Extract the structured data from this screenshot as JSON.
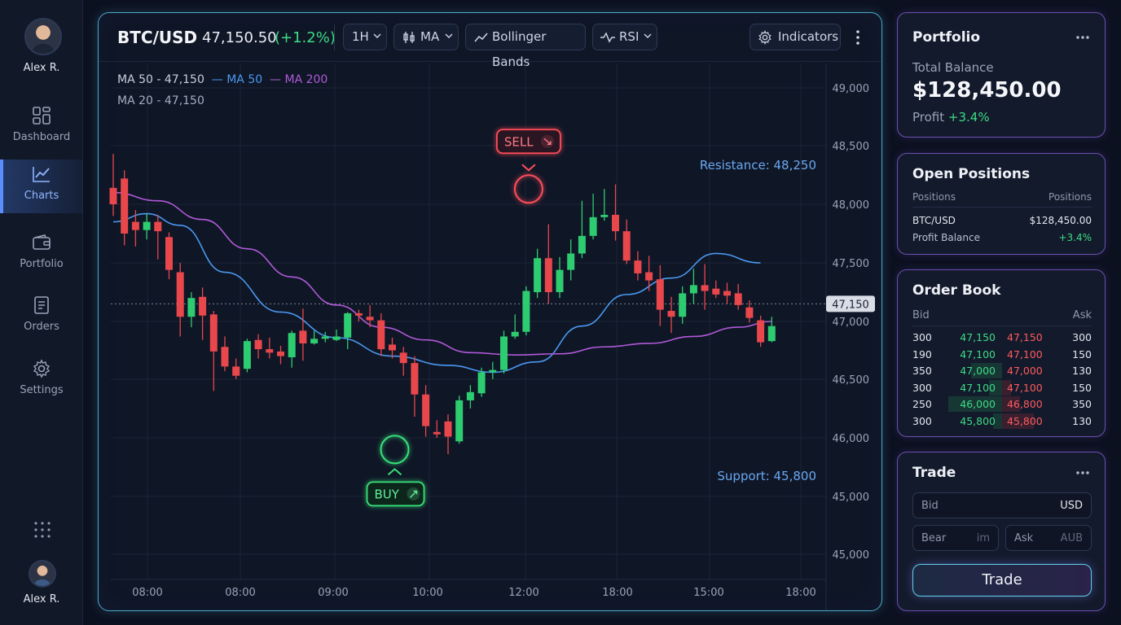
{
  "user": {
    "name_top": "Alex R.",
    "name_bottom": "Alex R."
  },
  "nav": {
    "items": [
      {
        "label": "Dashboard",
        "icon": "dashboard-icon"
      },
      {
        "label": "Charts",
        "icon": "chart-line-icon",
        "active": true
      },
      {
        "label": "Portfolio",
        "icon": "wallet-icon"
      },
      {
        "label": "Orders",
        "icon": "document-icon"
      },
      {
        "label": "Settings",
        "icon": "gear-icon"
      }
    ]
  },
  "toolbar": {
    "pair": "BTC/USD",
    "price": "47,150.50",
    "change": "(+1.2%)",
    "timeframe": "1H",
    "ma": "MA",
    "bollinger": "Bollinger Bands",
    "rsi": "RSI",
    "indicators": "Indicators"
  },
  "legend": {
    "ma50_value": "MA 50 - 47,150",
    "ma50": "— MA 50",
    "ma200": "— MA 200",
    "ma20_value": "MA 20 - 47,150"
  },
  "chart_data": {
    "type": "candlestick",
    "y_ticks": [
      "49,000",
      "48,500",
      "48,000",
      "47,500",
      "47,000",
      "46,500",
      "46,000",
      "45,000",
      "45,000"
    ],
    "x_ticks": [
      "08:00",
      "08:00",
      "09:00",
      "10:00",
      "12:00",
      "18:00",
      "15:00",
      "18:00"
    ],
    "ylim": [
      44900,
      49100
    ],
    "current_price": 47150,
    "current_price_label": "47,150",
    "resistance": {
      "value": 48250,
      "label": "Resistance: 48,250"
    },
    "support": {
      "value": 45800,
      "label": "Support: 45,800"
    },
    "signals": [
      {
        "type": "sell",
        "label": "SELL",
        "index": 37,
        "price": 48130
      },
      {
        "type": "buy",
        "label": "BUY",
        "index": 25,
        "price": 45900
      }
    ],
    "candles": [
      {
        "o": 48140,
        "h": 48430,
        "c": 48000,
        "l": 47900
      },
      {
        "o": 48220,
        "h": 48290,
        "c": 47750,
        "l": 47650
      },
      {
        "o": 47850,
        "h": 47950,
        "c": 47780,
        "l": 47640
      },
      {
        "o": 47780,
        "h": 47920,
        "c": 47850,
        "l": 47700
      },
      {
        "o": 47850,
        "h": 47910,
        "c": 47770,
        "l": 47530
      },
      {
        "o": 47720,
        "h": 47760,
        "c": 47440,
        "l": 47360
      },
      {
        "o": 47420,
        "h": 47500,
        "c": 47040,
        "l": 46870
      },
      {
        "o": 47040,
        "h": 47250,
        "c": 47200,
        "l": 46950
      },
      {
        "o": 47210,
        "h": 47290,
        "c": 47050,
        "l": 46840
      },
      {
        "o": 47060,
        "h": 47090,
        "c": 46740,
        "l": 46400
      },
      {
        "o": 46780,
        "h": 46870,
        "c": 46610,
        "l": 46570
      },
      {
        "o": 46610,
        "h": 46680,
        "c": 46530,
        "l": 46500
      },
      {
        "o": 46590,
        "h": 46850,
        "c": 46830,
        "l": 46560
      },
      {
        "o": 46840,
        "h": 46890,
        "c": 46760,
        "l": 46680
      },
      {
        "o": 46760,
        "h": 46860,
        "c": 46730,
        "l": 46680
      },
      {
        "o": 46740,
        "h": 46790,
        "c": 46700,
        "l": 46630
      },
      {
        "o": 46690,
        "h": 46920,
        "c": 46900,
        "l": 46600
      },
      {
        "o": 46920,
        "h": 47110,
        "c": 46810,
        "l": 46660
      },
      {
        "o": 46810,
        "h": 46920,
        "c": 46850,
        "l": 46800
      },
      {
        "o": 46850,
        "h": 46910,
        "c": 46870,
        "l": 46820
      },
      {
        "o": 46840,
        "h": 46930,
        "c": 46870,
        "l": 46830
      },
      {
        "o": 46860,
        "h": 47080,
        "c": 47070,
        "l": 46760
      },
      {
        "o": 47070,
        "h": 47100,
        "c": 47050,
        "l": 47000
      },
      {
        "o": 47040,
        "h": 47140,
        "c": 47010,
        "l": 46950
      },
      {
        "o": 47010,
        "h": 47070,
        "c": 46760,
        "l": 46700
      },
      {
        "o": 46800,
        "h": 46860,
        "c": 46750,
        "l": 46680
      },
      {
        "o": 46730,
        "h": 46780,
        "c": 46640,
        "l": 46530
      },
      {
        "o": 46640,
        "h": 46700,
        "c": 46370,
        "l": 46180
      },
      {
        "o": 46370,
        "h": 46450,
        "c": 46100,
        "l": 46010
      },
      {
        "o": 46050,
        "h": 46150,
        "c": 46030,
        "l": 46000
      },
      {
        "o": 46140,
        "h": 46200,
        "c": 46010,
        "l": 45860
      },
      {
        "o": 45970,
        "h": 46360,
        "c": 46320,
        "l": 45950
      },
      {
        "o": 46320,
        "h": 46450,
        "c": 46390,
        "l": 46250
      },
      {
        "o": 46380,
        "h": 46600,
        "c": 46560,
        "l": 46350
      },
      {
        "o": 46560,
        "h": 46650,
        "c": 46580,
        "l": 46500
      },
      {
        "o": 46580,
        "h": 46920,
        "c": 46870,
        "l": 46550
      },
      {
        "o": 46870,
        "h": 47060,
        "c": 46910,
        "l": 46850
      },
      {
        "o": 46910,
        "h": 47300,
        "c": 47260,
        "l": 46880
      },
      {
        "o": 47250,
        "h": 47620,
        "c": 47540,
        "l": 47200
      },
      {
        "o": 47540,
        "h": 47830,
        "c": 47250,
        "l": 47150
      },
      {
        "o": 47250,
        "h": 47550,
        "c": 47440,
        "l": 47200
      },
      {
        "o": 47440,
        "h": 47700,
        "c": 47580,
        "l": 47350
      },
      {
        "o": 47580,
        "h": 48030,
        "c": 47730,
        "l": 47540
      },
      {
        "o": 47730,
        "h": 48090,
        "c": 47890,
        "l": 47700
      },
      {
        "o": 47890,
        "h": 48130,
        "c": 47910,
        "l": 47860
      },
      {
        "o": 47910,
        "h": 48170,
        "c": 47770,
        "l": 47690
      },
      {
        "o": 47770,
        "h": 47870,
        "c": 47520,
        "l": 47490
      },
      {
        "o": 47520,
        "h": 47600,
        "c": 47410,
        "l": 47350
      },
      {
        "o": 47420,
        "h": 47560,
        "c": 47350,
        "l": 47260
      },
      {
        "o": 47360,
        "h": 47480,
        "c": 47100,
        "l": 46960
      },
      {
        "o": 47090,
        "h": 47210,
        "c": 47040,
        "l": 46900
      },
      {
        "o": 47040,
        "h": 47300,
        "c": 47240,
        "l": 46980
      },
      {
        "o": 47240,
        "h": 47450,
        "c": 47310,
        "l": 47150
      },
      {
        "o": 47310,
        "h": 47490,
        "c": 47260,
        "l": 47100
      },
      {
        "o": 47280,
        "h": 47350,
        "c": 47230,
        "l": 47200
      },
      {
        "o": 47260,
        "h": 47330,
        "c": 47220,
        "l": 47150
      },
      {
        "o": 47240,
        "h": 47320,
        "c": 47140,
        "l": 47100
      },
      {
        "o": 47120,
        "h": 47180,
        "c": 47030,
        "l": 46990
      },
      {
        "o": 47010,
        "h": 47050,
        "c": 46820,
        "l": 46780
      },
      {
        "o": 46830,
        "h": 47040,
        "c": 46960,
        "l": 46820
      }
    ],
    "series": [
      {
        "name": "MA 50",
        "color": "#4a98f0",
        "x": [
          0,
          3,
          6,
          10,
          15,
          20,
          25,
          30,
          34,
          38,
          42,
          46,
          50,
          54,
          58
        ],
        "y": [
          47850,
          47920,
          47820,
          47420,
          47080,
          46860,
          46700,
          46620,
          46560,
          46650,
          46960,
          47230,
          47370,
          47580,
          47500
        ]
      },
      {
        "name": "MA 200",
        "color": "#b05ad8",
        "x": [
          0,
          4,
          8,
          12,
          16,
          20,
          24,
          28,
          32,
          36,
          40,
          44,
          48,
          52,
          56,
          59
        ],
        "y": [
          48100,
          48030,
          47870,
          47620,
          47380,
          47140,
          46950,
          46840,
          46730,
          46710,
          46720,
          46780,
          46810,
          46870,
          46950,
          47000
        ]
      }
    ]
  },
  "portfolio": {
    "title": "Portfolio",
    "balance_label": "Total Balance",
    "balance": "$128,450.00",
    "profit_label": "Profit",
    "profit": "+3.4%"
  },
  "positions": {
    "title": "Open Positions",
    "head_left": "Positions",
    "head_right": "Positions",
    "rows": [
      {
        "left": "BTC/USD",
        "right": "$128,450.00"
      },
      {
        "left": "Profit Balance",
        "right": "+3.4%"
      }
    ]
  },
  "orderbook": {
    "title": "Order Book",
    "bid_label": "Bid",
    "ask_label": "Ask",
    "rows": [
      {
        "bid_qty": "300",
        "bid": "47,150",
        "ask": "47,150",
        "ask_qty": "300",
        "gbar": 0,
        "rbar": 0
      },
      {
        "bid_qty": "190",
        "bid": "47,100",
        "ask": "47,100",
        "ask_qty": "150",
        "gbar": 0,
        "rbar": 0
      },
      {
        "bid_qty": "350",
        "bid": "47,000",
        "ask": "47,000",
        "ask_qty": "130",
        "gbar": 0.35,
        "rbar": 0
      },
      {
        "bid_qty": "300",
        "bid": "47,100",
        "ask": "47,100",
        "ask_qty": "150",
        "gbar": 0.15,
        "rbar": 0.1
      },
      {
        "bid_qty": "250",
        "bid": "46,000",
        "ask": "46,800",
        "ask_qty": "350",
        "gbar": 0.6,
        "rbar": 0.2
      },
      {
        "bid_qty": "300",
        "bid": "45,800",
        "ask": "45,800",
        "ask_qty": "130",
        "gbar": 0.1,
        "rbar": 0.35
      }
    ]
  },
  "trade": {
    "title": "Trade",
    "bid_placeholder": "Bid",
    "bid_suffix": "USD",
    "bear_placeholder": "Bear",
    "bear_suffix": "im",
    "ask_placeholder": "Ask",
    "ask_suffix": "AUB",
    "button": "Trade"
  },
  "colors": {
    "up": "#2ecc71",
    "down": "#e8474c",
    "accent": "#4aa8c8",
    "resistance": "#3d8ef0",
    "support": "#3d8ef0"
  }
}
